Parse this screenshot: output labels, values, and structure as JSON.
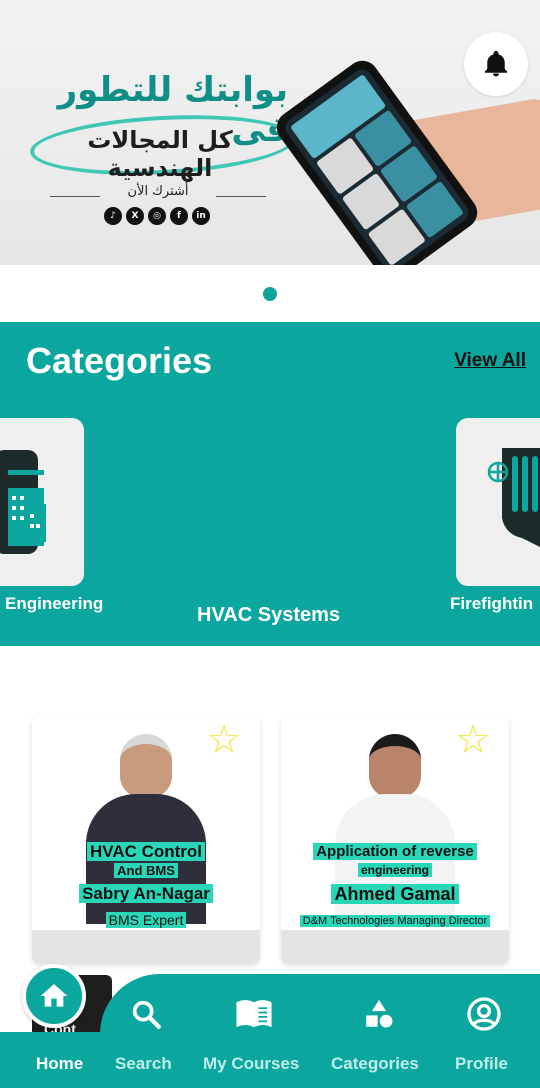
{
  "banner": {
    "headline": "بوابتك للتطور فى",
    "headline2": "كل المجالات الهندسية",
    "subscribe": "أشترك الأن",
    "social": [
      {
        "name": "tiktok-icon",
        "glyph": "♪"
      },
      {
        "name": "x-icon",
        "glyph": "X"
      },
      {
        "name": "instagram-icon",
        "glyph": "◎"
      },
      {
        "name": "facebook-icon",
        "glyph": "f"
      },
      {
        "name": "linkedin-icon",
        "glyph": "in"
      }
    ],
    "slide_indicator": {
      "current": 1,
      "total": 1
    }
  },
  "notifications": {
    "icon": "bell-icon"
  },
  "categories": {
    "title": "Categories",
    "view_all": "View All",
    "items": [
      {
        "label": "Engineering",
        "icon": "building-icon"
      },
      {
        "label": "HVAC Systems",
        "icon": "hvac-icon"
      },
      {
        "label": "Firefightin",
        "icon": "firefighting-icon"
      }
    ]
  },
  "courses": [
    {
      "title_line1": "HVAC Control",
      "title_line2": "And BMS",
      "instructor": "Sabry An-Nagar",
      "role": "BMS Expert"
    },
    {
      "title_line1": "Application of reverse",
      "title_line2": "engineering",
      "instructor": "Ahmed Gamal",
      "role": "D&M Technologies Managing Director"
    }
  ],
  "peek_card": {
    "line1": "odu",
    "line2": "Cont"
  },
  "bottom_nav": {
    "items": [
      {
        "label": "Home",
        "icon": "home-icon",
        "active": true
      },
      {
        "label": "Search",
        "icon": "search-icon",
        "active": false
      },
      {
        "label": "My Courses",
        "icon": "book-icon",
        "active": false
      },
      {
        "label": "Categories",
        "icon": "shapes-icon",
        "active": false
      },
      {
        "label": "Profile",
        "icon": "profile-icon",
        "active": false
      }
    ]
  },
  "colors": {
    "primary": "#0ba69d",
    "highlight": "#2ad6b8",
    "star": "#f4e542"
  }
}
